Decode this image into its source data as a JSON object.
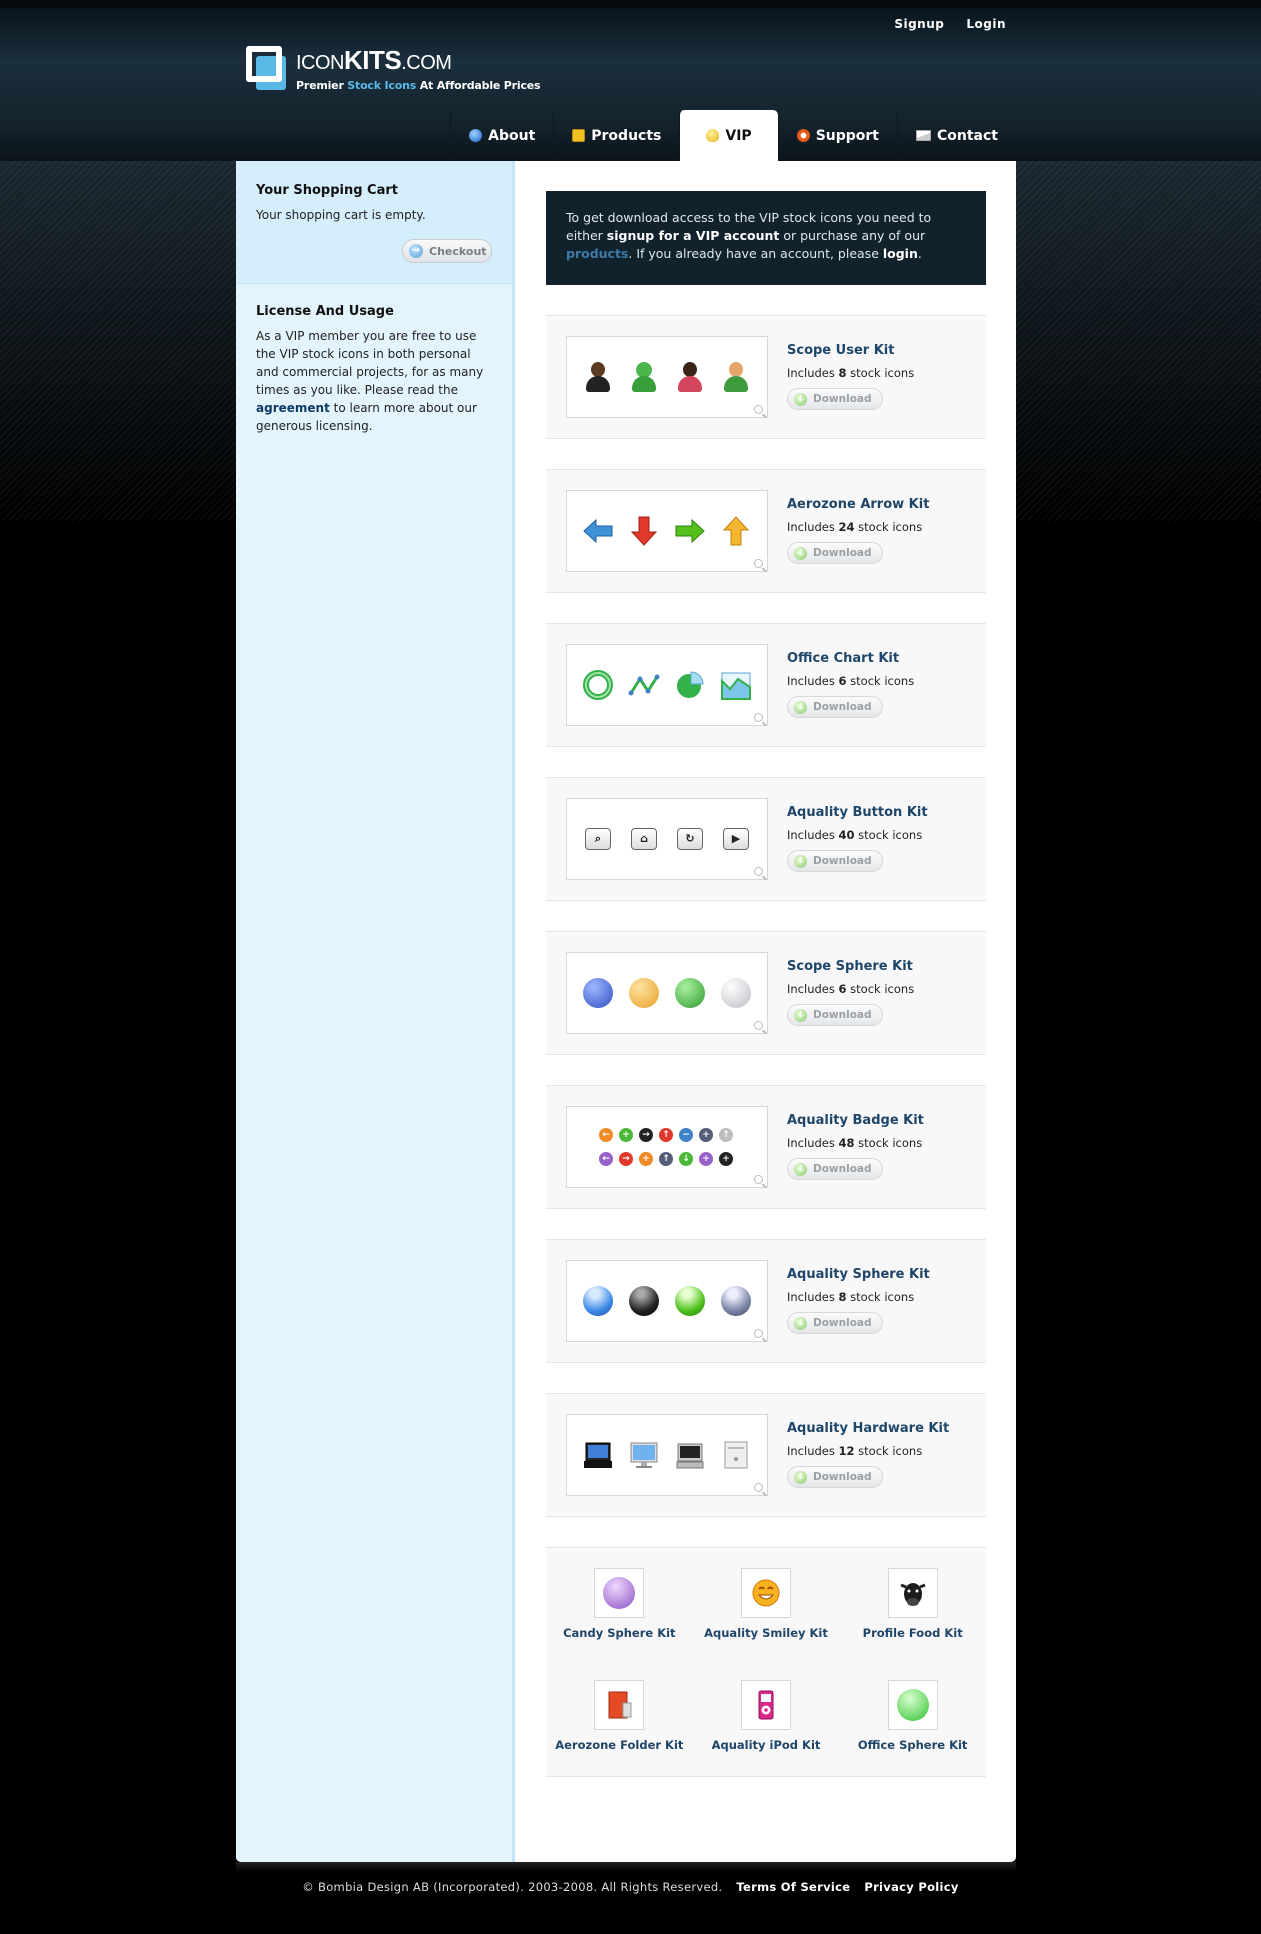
{
  "toplinks": {
    "signup": "Signup",
    "login": "Login"
  },
  "logo": {
    "title_a": "ICON",
    "title_b": "KITS",
    "title_c": ".COM",
    "tag_a": "Premier ",
    "tag_b": "Stock Icons",
    "tag_c": " At Affordable Prices"
  },
  "nav": {
    "about": "About",
    "products": "Products",
    "vip": "VIP",
    "support": "Support",
    "contact": "Contact"
  },
  "sidebar": {
    "cart_title": "Your Shopping Cart",
    "cart_text": "Your shopping cart is empty.",
    "checkout": "Checkout",
    "license_title": "License And Usage",
    "license_text_a": "As a VIP member you are free to use the VIP stock icons in both personal and commercial projects, for as many times as you like. Please read the ",
    "license_link": "agreement",
    "license_text_b": " to learn more about our generous licensing."
  },
  "notice": {
    "a": "To get download access to the VIP stock icons you need to either ",
    "signup": "signup for a VIP account",
    "b": " or purchase any of our ",
    "products": "products",
    "c": ". If you already have an account, please ",
    "login": "login",
    "d": "."
  },
  "kits": [
    {
      "name": "Scope User Kit",
      "count": "8"
    },
    {
      "name": "Aerozone Arrow Kit",
      "count": "24"
    },
    {
      "name": "Office Chart Kit",
      "count": "6"
    },
    {
      "name": "Aquality Button Kit",
      "count": "40"
    },
    {
      "name": "Scope Sphere Kit",
      "count": "6"
    },
    {
      "name": "Aquality Badge Kit",
      "count": "48"
    },
    {
      "name": "Aquality Sphere Kit",
      "count": "8"
    },
    {
      "name": "Aquality Hardware Kit",
      "count": "12"
    }
  ],
  "kit_labels": {
    "includes": "Includes ",
    "stock_icons": " stock icons",
    "download": "Download"
  },
  "grid_kits": [
    {
      "name": "Candy Sphere Kit"
    },
    {
      "name": "Aquality Smiley Kit"
    },
    {
      "name": "Profile Food Kit"
    },
    {
      "name": "Aerozone Folder Kit"
    },
    {
      "name": "Aquality iPod Kit"
    },
    {
      "name": "Office Sphere Kit"
    }
  ],
  "footer": {
    "copyright": "© Bombia Design AB (Incorporated). 2003-2008. All Rights Reserved.",
    "terms": "Terms Of Service",
    "privacy": "Privacy Policy"
  }
}
